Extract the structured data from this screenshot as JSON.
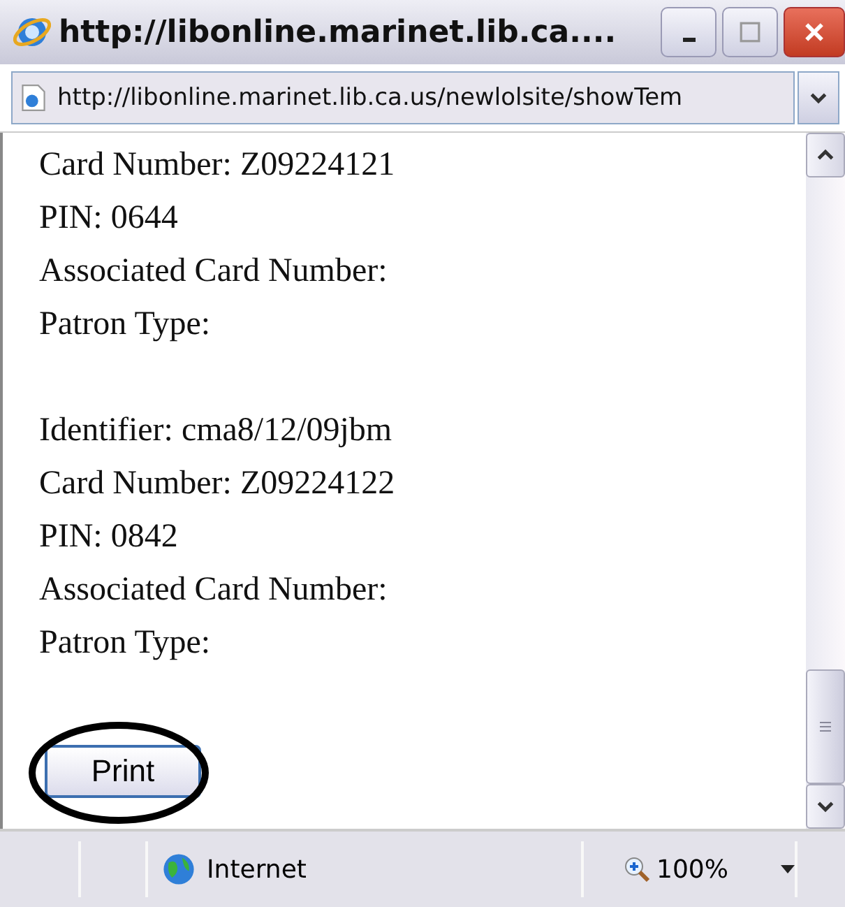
{
  "window": {
    "title": "http://libonline.marinet.lib.ca...."
  },
  "address_bar": {
    "value": "http://libonline.marinet.lib.ca.us/newlolsite/showTem"
  },
  "records": [
    {
      "lines": [
        "Card Number: Z09224121",
        "PIN: 0644",
        "Associated Card Number:",
        "Patron Type:"
      ]
    },
    {
      "lines": [
        "Identifier: cma8/12/09jbm",
        "Card Number: Z09224122",
        "PIN: 0842",
        "Associated Card Number:",
        "Patron Type:"
      ]
    }
  ],
  "print_button": {
    "label": "Print"
  },
  "status_bar": {
    "zone": "Internet",
    "zoom": "100%"
  }
}
